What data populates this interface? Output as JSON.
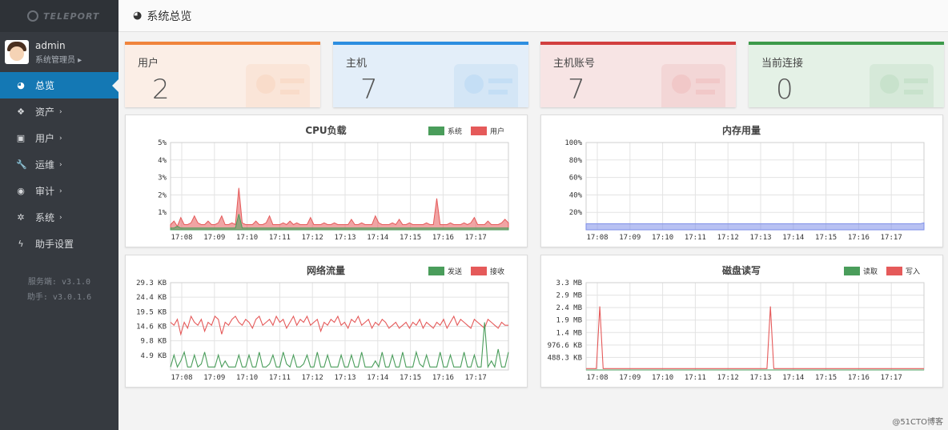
{
  "app": {
    "logo_text": "TELEPORT"
  },
  "user": {
    "name": "admin",
    "role": "系统管理员 ▸"
  },
  "nav": [
    {
      "label": "总览",
      "icon": "dashboard-icon",
      "glyph": "◕",
      "active": true,
      "caret": ""
    },
    {
      "label": "资产",
      "icon": "cubes-icon",
      "glyph": "❖",
      "active": false,
      "caret": "›"
    },
    {
      "label": "用户",
      "icon": "address-book-icon",
      "glyph": "▣",
      "active": false,
      "caret": "›"
    },
    {
      "label": "运维",
      "icon": "wrench-icon",
      "glyph": "🔧",
      "active": false,
      "caret": "›"
    },
    {
      "label": "审计",
      "icon": "eye-icon",
      "glyph": "◉",
      "active": false,
      "caret": "›"
    },
    {
      "label": "系统",
      "icon": "gear-icon",
      "glyph": "✲",
      "active": false,
      "caret": "›"
    },
    {
      "label": "助手设置",
      "icon": "bolt-icon",
      "glyph": "ϟ",
      "active": false,
      "caret": ""
    }
  ],
  "version": {
    "server": "服务端: v3.1.0",
    "assist": "助手: v3.0.1.6"
  },
  "header": {
    "title": "系统总览"
  },
  "stats": [
    {
      "label": "用户",
      "value": "2",
      "color": "#f0843c",
      "bg": "#fbeee6",
      "icon": "id-card-icon"
    },
    {
      "label": "主机",
      "value": "7",
      "color": "#2d8ee0",
      "bg": "#e3eef9",
      "icon": "cubes-icon"
    },
    {
      "label": "主机账号",
      "value": "7",
      "color": "#d23f3f",
      "bg": "#f7e4e4",
      "icon": "user-secret-icon"
    },
    {
      "label": "当前连接",
      "value": "0",
      "color": "#3c9a4a",
      "bg": "#e4f1e6",
      "icon": "link-icon"
    }
  ],
  "colors": {
    "green": "#4a9d5b",
    "red": "#e55a5a",
    "blue": "#7d8ee8"
  },
  "watermark": "@51CTO博客",
  "chart_data": [
    {
      "type": "area",
      "title": "CPU负载",
      "x_ticks": [
        "17:08",
        "17:09",
        "17:10",
        "17:11",
        "17:12",
        "17:13",
        "17:14",
        "17:15",
        "17:16",
        "17:17"
      ],
      "y_ticks": [
        "5%",
        "4%",
        "3%",
        "2%",
        "1%"
      ],
      "ylim": [
        0,
        5
      ],
      "legend": [
        "系统",
        "用户"
      ],
      "series": [
        {
          "name": "系统",
          "color": "#4a9d5b",
          "values": [
            0.1,
            0.1,
            0.2,
            0.1,
            0.1,
            0.1,
            0.1,
            0.1,
            0.1,
            0.1,
            0.1,
            0.1,
            0.1,
            0.1,
            0.1,
            0.1,
            0.1,
            0.1,
            0.1,
            0.1,
            0.9,
            0.1,
            0.1,
            0.1,
            0.1,
            0.1,
            0.1,
            0.1,
            0.1,
            0.1,
            0.1,
            0.1,
            0.1,
            0.1,
            0.1,
            0.1,
            0.1,
            0.1,
            0.1,
            0.1,
            0.1,
            0.1,
            0.1,
            0.1,
            0.1,
            0.1,
            0.1,
            0.1,
            0.1,
            0.1,
            0.1,
            0.1,
            0.1,
            0.1,
            0.1,
            0.1,
            0.1,
            0.1,
            0.1,
            0.1,
            0.1,
            0.1,
            0.1,
            0.1,
            0.1,
            0.1,
            0.1,
            0.1,
            0.1,
            0.1,
            0.1,
            0.1,
            0.1,
            0.1,
            0.1,
            0.1,
            0.1,
            0.1,
            0.1,
            0.1,
            0.1,
            0.1,
            0.1,
            0.1,
            0.1,
            0.1,
            0.1,
            0.1,
            0.1,
            0.1,
            0.1,
            0.1,
            0.1,
            0.1,
            0.1,
            0.1,
            0.1,
            0.1,
            0.1,
            0.1
          ]
        },
        {
          "name": "用户",
          "color": "#e55a5a",
          "values": [
            0.3,
            0.5,
            0.2,
            0.7,
            0.3,
            0.3,
            0.4,
            0.8,
            0.4,
            0.3,
            0.3,
            0.5,
            0.3,
            0.3,
            0.4,
            0.8,
            0.3,
            0.3,
            0.4,
            0.3,
            2.4,
            0.4,
            0.3,
            0.3,
            0.3,
            0.5,
            0.3,
            0.3,
            0.4,
            0.8,
            0.3,
            0.3,
            0.3,
            0.4,
            0.3,
            0.5,
            0.3,
            0.4,
            0.3,
            0.3,
            0.3,
            0.7,
            0.3,
            0.3,
            0.3,
            0.4,
            0.3,
            0.3,
            0.4,
            0.3,
            0.3,
            0.3,
            0.3,
            0.6,
            0.3,
            0.3,
            0.4,
            0.3,
            0.3,
            0.3,
            0.8,
            0.4,
            0.3,
            0.3,
            0.3,
            0.4,
            0.3,
            0.6,
            0.3,
            0.3,
            0.4,
            0.3,
            0.3,
            0.3,
            0.3,
            0.4,
            0.3,
            0.3,
            1.8,
            0.3,
            0.3,
            0.3,
            0.4,
            0.3,
            0.3,
            0.3,
            0.4,
            0.3,
            0.4,
            0.7,
            0.3,
            0.3,
            0.3,
            0.5,
            0.3,
            0.3,
            0.3,
            0.4,
            0.6,
            0.4
          ]
        }
      ]
    },
    {
      "type": "area",
      "title": "内存用量",
      "x_ticks": [
        "17:08",
        "17:09",
        "17:10",
        "17:11",
        "17:12",
        "17:13",
        "17:14",
        "17:15",
        "17:16",
        "17:17"
      ],
      "y_ticks": [
        "100%",
        "80%",
        "60%",
        "40%",
        "20%"
      ],
      "ylim": [
        0,
        100
      ],
      "legend": [],
      "series": [
        {
          "color": "#7d8ee8",
          "values": [
            7,
            7,
            7,
            7,
            7,
            7,
            7,
            7,
            7,
            7,
            7,
            7,
            7,
            7,
            7,
            7,
            7,
            7,
            7,
            7,
            7,
            7,
            7,
            7,
            7,
            7,
            7,
            7,
            7,
            7,
            7,
            7,
            7,
            7,
            7,
            7,
            7,
            7,
            7,
            7,
            7,
            7,
            7,
            7,
            7,
            7,
            7,
            7,
            7,
            7,
            7,
            7,
            7,
            7,
            7,
            7,
            7,
            7,
            7,
            7,
            7,
            7,
            7,
            7,
            7,
            7,
            7,
            7,
            7,
            7,
            7,
            7,
            7,
            7,
            7,
            7,
            7,
            7,
            7,
            7,
            7,
            7,
            7,
            7,
            7,
            7,
            7,
            7,
            7,
            7,
            7,
            7,
            7,
            7,
            7,
            7,
            7,
            7,
            7,
            8
          ]
        }
      ]
    },
    {
      "type": "line",
      "title": "网络流量",
      "x_ticks": [
        "17:08",
        "17:09",
        "17:10",
        "17:11",
        "17:12",
        "17:13",
        "17:14",
        "17:15",
        "17:16",
        "17:17"
      ],
      "y_ticks": [
        "29.3 KB",
        "24.4 KB",
        "19.5 KB",
        "14.6 KB",
        "9.8 KB",
        "4.9 KB"
      ],
      "ylim": [
        0,
        29.3
      ],
      "legend": [
        "发送",
        "接收"
      ],
      "series": [
        {
          "name": "发送",
          "color": "#4a9d5b",
          "values": [
            1,
            5,
            1,
            3,
            6,
            1,
            1,
            5,
            1,
            2,
            6,
            1,
            1,
            1,
            5,
            1,
            3,
            1,
            1,
            1,
            5,
            1,
            1,
            5,
            1,
            1,
            6,
            1,
            1,
            2,
            5,
            1,
            1,
            6,
            2,
            1,
            5,
            1,
            1,
            2,
            5,
            1,
            1,
            6,
            1,
            1,
            5,
            1,
            1,
            1,
            5,
            1,
            1,
            5,
            1,
            1,
            6,
            1,
            1,
            1,
            3,
            1,
            6,
            1,
            1,
            5,
            1,
            1,
            6,
            1,
            1,
            1,
            6,
            2,
            1,
            5,
            1,
            1,
            1,
            6,
            1,
            1,
            5,
            1,
            1,
            1,
            6,
            1,
            1,
            5,
            1,
            1,
            16,
            1,
            3,
            1,
            7,
            1,
            1,
            6
          ]
        },
        {
          "name": "接收",
          "color": "#e55a5a",
          "values": [
            16,
            15,
            17,
            12,
            16,
            14,
            18,
            16,
            15,
            17,
            13,
            16,
            15,
            18,
            17,
            12,
            16,
            15,
            17,
            18,
            16,
            15,
            17,
            16,
            14,
            17,
            18,
            15,
            16,
            17,
            15,
            18,
            16,
            17,
            14,
            16,
            18,
            15,
            17,
            16,
            18,
            15,
            16,
            17,
            13,
            16,
            15,
            17,
            16,
            18,
            15,
            16,
            14,
            17,
            16,
            18,
            15,
            16,
            17,
            14,
            16,
            15,
            17,
            16,
            14,
            15,
            16,
            14,
            15,
            16,
            14,
            16,
            15,
            17,
            14,
            16,
            15,
            14,
            16,
            15,
            17,
            14,
            16,
            18,
            15,
            17,
            16,
            15,
            14,
            17,
            16,
            15,
            14,
            17,
            16,
            15,
            14,
            16,
            15,
            15
          ]
        }
      ]
    },
    {
      "type": "line",
      "title": "磁盘读写",
      "x_ticks": [
        "17:08",
        "17:09",
        "17:10",
        "17:11",
        "17:12",
        "17:13",
        "17:14",
        "17:15",
        "17:16",
        "17:17"
      ],
      "y_ticks": [
        "3.3 MB",
        "2.9 MB",
        "2.4 MB",
        "1.9 MB",
        "1.4 MB",
        "976.6 KB",
        "488.3 KB"
      ],
      "ylim": [
        0,
        3.3
      ],
      "legend": [
        "读取",
        "写入"
      ],
      "series": [
        {
          "name": "读取",
          "color": "#4a9d5b",
          "values": [
            0,
            0,
            0,
            0,
            0,
            0,
            0,
            0,
            0,
            0,
            0,
            0,
            0,
            0,
            0,
            0,
            0,
            0,
            0,
            0,
            0,
            0,
            0,
            0,
            0,
            0,
            0,
            0,
            0,
            0,
            0,
            0,
            0,
            0,
            0,
            0,
            0,
            0,
            0,
            0,
            0,
            0,
            0,
            0,
            0,
            0,
            0,
            0,
            0,
            0,
            0,
            0,
            0,
            0,
            0,
            0,
            0,
            0,
            0,
            0,
            0,
            0,
            0,
            0,
            0,
            0,
            0,
            0,
            0,
            0,
            0,
            0,
            0,
            0,
            0,
            0,
            0,
            0,
            0,
            0,
            0,
            0,
            0,
            0,
            0,
            0,
            0,
            0,
            0,
            0,
            0,
            0,
            0,
            0,
            0,
            0,
            0,
            0,
            0,
            0
          ]
        },
        {
          "name": "写入",
          "color": "#e55a5a",
          "values": [
            0.05,
            0.05,
            0.05,
            0.05,
            2.4,
            0.05,
            0.05,
            0.05,
            0.05,
            0.05,
            0.05,
            0.05,
            0.05,
            0.05,
            0.05,
            0.05,
            0.05,
            0.05,
            0.05,
            0.05,
            0.05,
            0.05,
            0.05,
            0.05,
            0.05,
            0.05,
            0.05,
            0.05,
            0.05,
            0.05,
            0.05,
            0.05,
            0.05,
            0.05,
            0.05,
            0.05,
            0.05,
            0.05,
            0.05,
            0.05,
            0.05,
            0.05,
            0.05,
            0.05,
            0.05,
            0.05,
            0.05,
            0.05,
            0.05,
            0.05,
            0.05,
            0.05,
            0.05,
            0.05,
            2.4,
            0.05,
            0.05,
            0.05,
            0.05,
            0.05,
            0.05,
            0.05,
            0.05,
            0.05,
            0.05,
            0.05,
            0.05,
            0.05,
            0.05,
            0.05,
            0.05,
            0.05,
            0.05,
            0.05,
            0.05,
            0.05,
            0.05,
            0.05,
            0.05,
            0.05,
            0.05,
            0.05,
            0.05,
            0.05,
            0.05,
            0.05,
            0.05,
            0.05,
            0.05,
            0.05,
            0.05,
            0.05,
            0.05,
            0.05,
            0.05,
            0.05,
            0.05,
            0.05,
            0.05,
            0.05
          ]
        }
      ]
    }
  ]
}
